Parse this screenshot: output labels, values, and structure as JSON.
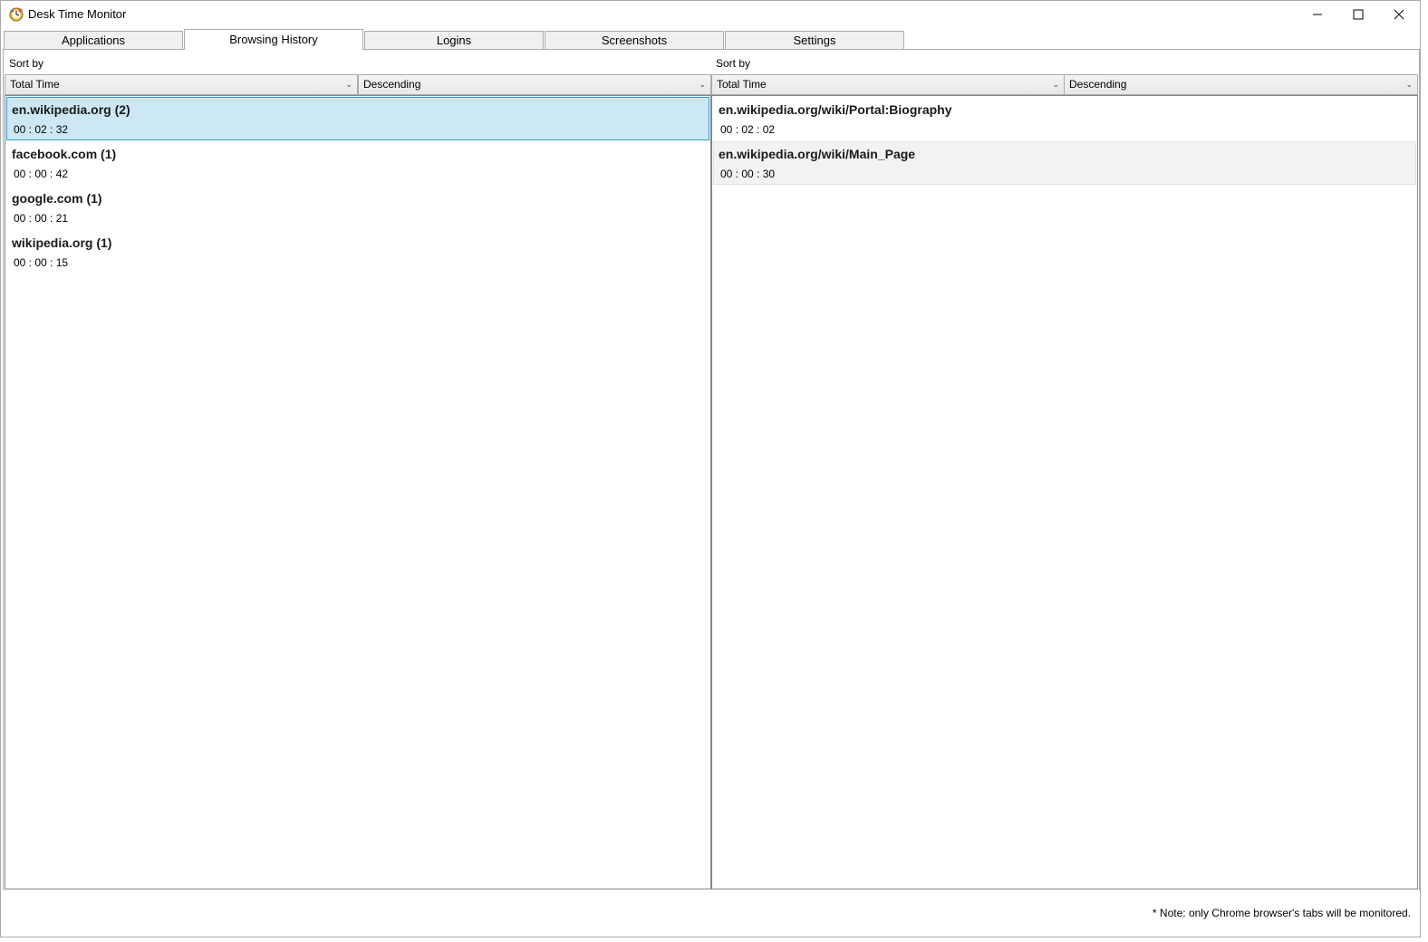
{
  "window": {
    "title": "Desk Time Monitor"
  },
  "tabs": [
    {
      "label": "Applications",
      "active": false
    },
    {
      "label": "Browsing History",
      "active": true
    },
    {
      "label": "Logins",
      "active": false
    },
    {
      "label": "Screenshots",
      "active": false
    },
    {
      "label": "Settings",
      "active": false
    }
  ],
  "left_pane": {
    "sort_label": "Sort by",
    "sort_field": "Total Time",
    "sort_order": "Descending",
    "items": [
      {
        "name": "en.wikipedia.org (2)",
        "time": "00 : 02 : 32",
        "selected": true
      },
      {
        "name": "facebook.com (1)",
        "time": "00 : 00 : 42"
      },
      {
        "name": "google.com (1)",
        "time": "00 : 00 : 21"
      },
      {
        "name": "wikipedia.org (1)",
        "time": "00 : 00 : 15"
      }
    ]
  },
  "right_pane": {
    "sort_label": "Sort by",
    "sort_field": "Total Time",
    "sort_order": "Descending",
    "items": [
      {
        "name": "en.wikipedia.org/wiki/Portal:Biography",
        "time": "00 : 02 : 02"
      },
      {
        "name": "en.wikipedia.org/wiki/Main_Page",
        "time": "00 : 00 : 30",
        "highlighted": true
      }
    ]
  },
  "footer": {
    "note": "* Note: only Chrome browser's tabs will be monitored."
  },
  "colors": {
    "selection_bg": "#cce8f4",
    "selection_border": "#26a0da"
  }
}
